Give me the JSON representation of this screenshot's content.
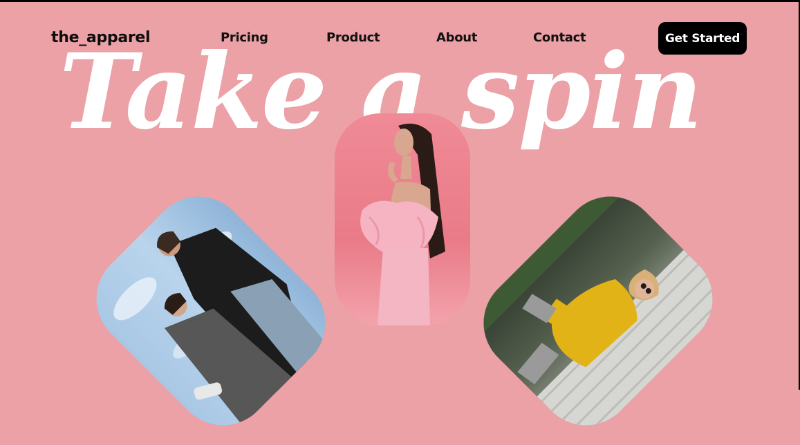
{
  "brand": {
    "logo": "the_apparel"
  },
  "nav": {
    "items": [
      {
        "label": "Pricing"
      },
      {
        "label": "Product"
      },
      {
        "label": "About"
      },
      {
        "label": "Contact"
      }
    ],
    "cta_label": "Get Started"
  },
  "hero": {
    "title": "Take a spin"
  },
  "colors": {
    "background": "#eba1a5",
    "text": "#0e0e0e",
    "button": "#000000",
    "hero_text": "#ffffff"
  }
}
